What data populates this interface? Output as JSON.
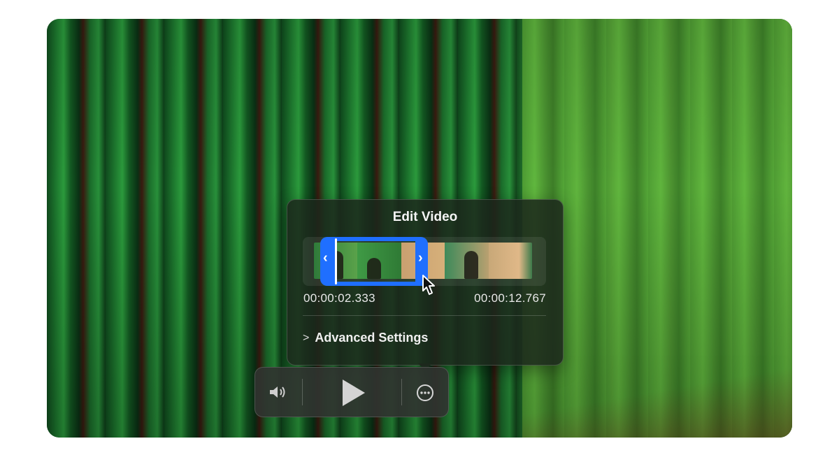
{
  "popover": {
    "title": "Edit Video",
    "trim": {
      "start_time": "00:00:02.333",
      "end_time": "00:00:12.767",
      "selected_fraction": 0.44
    },
    "advanced_settings_label": "Advanced Settings"
  },
  "controls": {
    "volume_icon": "speaker-icon",
    "play_icon": "play-icon",
    "more_icon": "ellipsis-circle-icon"
  },
  "colors": {
    "accent": "#1f6fff",
    "panel": "#1c281c"
  }
}
